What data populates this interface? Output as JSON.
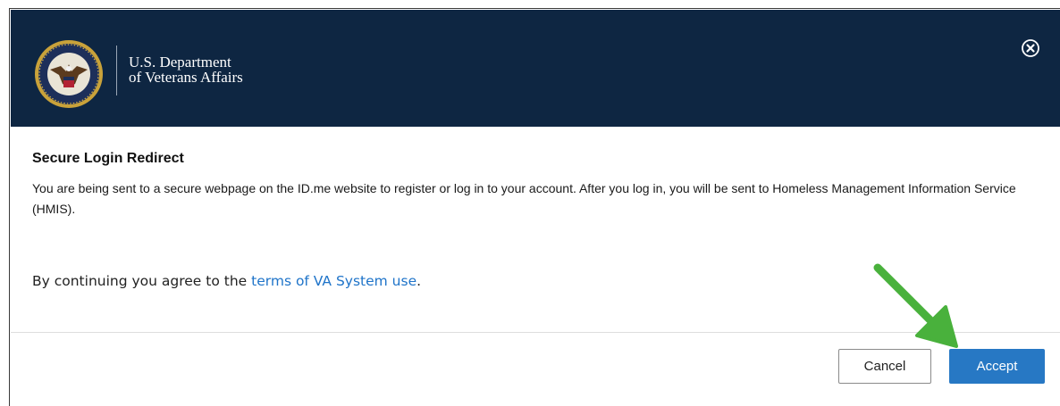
{
  "header": {
    "org_line1": "U.S. Department",
    "org_line2": "of Veterans Affairs",
    "close_icon": "close-circle-icon",
    "seal_icon": "va-seal-icon"
  },
  "dialog": {
    "title": "Secure Login Redirect",
    "message": "You are being sent to a secure webpage on the ID.me website to register or log in to your account. After you log in, you will be sent to Homeless Management Information Service (HMIS).",
    "consent_prefix": "By continuing you agree to the ",
    "consent_link": "terms of VA System use",
    "consent_suffix": "."
  },
  "footer": {
    "cancel_label": "Cancel",
    "accept_label": "Accept"
  },
  "annotation": {
    "arrow_color": "#49b13c",
    "arrow_icon": "green-arrow-icon"
  },
  "colors": {
    "header_bg": "#0e2642",
    "accept_bg": "#2778c4",
    "link": "#1f74c9"
  }
}
